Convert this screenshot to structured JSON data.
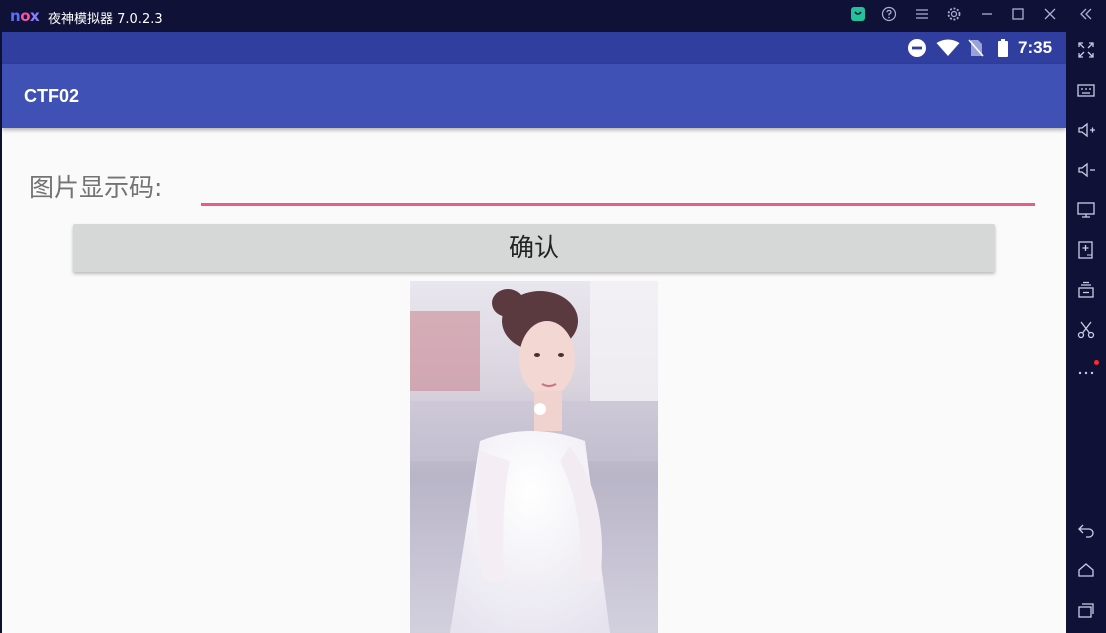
{
  "emulator": {
    "title": "夜神模拟器 7.0.2.3",
    "logo": {
      "n": "n",
      "o": "o",
      "x": "x"
    },
    "title_icons": [
      "bag-icon",
      "help-icon",
      "menu-icon",
      "gear-icon",
      "minimize-icon",
      "maximize-icon",
      "close-icon",
      "collapse-icon"
    ],
    "side_icons": [
      "fullscreen-icon",
      "keyboard-icon",
      "volume-up-icon",
      "volume-down-icon",
      "screen-icon",
      "apk-install-icon",
      "multi-instance-icon",
      "screenshot-scissors-icon",
      "more-icon",
      "back-icon",
      "home-icon",
      "recents-icon"
    ]
  },
  "statusbar": {
    "time": "7:35",
    "icons": [
      "do-not-disturb-icon",
      "wifi-icon",
      "no-sim-icon",
      "battery-icon"
    ]
  },
  "app": {
    "title": "CTF02",
    "field_label": "图片显示码:",
    "input_value": "",
    "confirm_label": "确认"
  },
  "colors": {
    "statusbar": "#303f9f",
    "appbar": "#3f51b5",
    "input_underline": "#e95b8d",
    "button": "#d6d7d7"
  }
}
